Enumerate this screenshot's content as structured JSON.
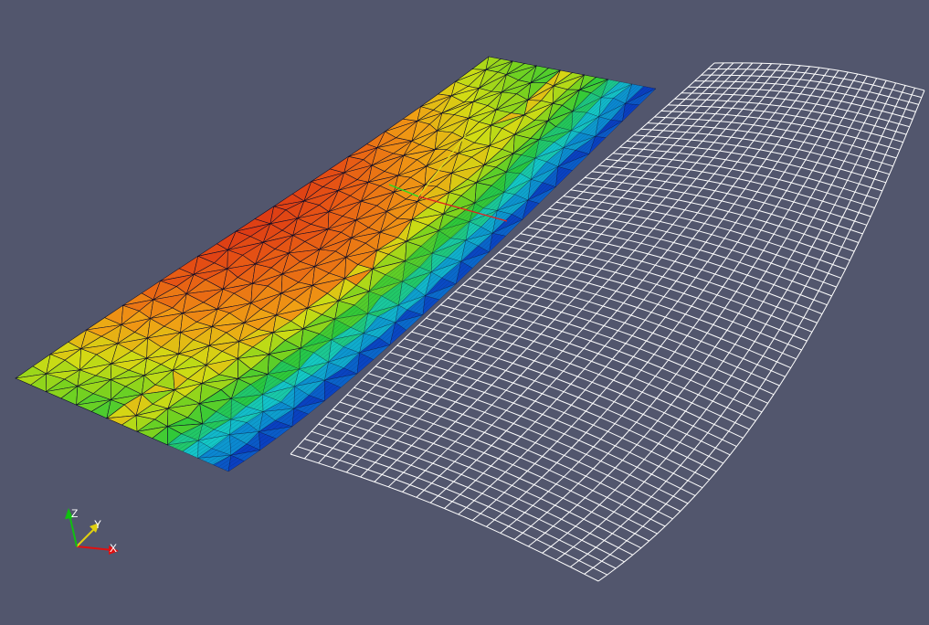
{
  "viewport": {
    "background_color": "#52566d"
  },
  "left_mesh": {
    "representation": "surface-with-edges",
    "edge_color": "#0a0a28",
    "colormap": [
      "#0a14b4",
      "#0a82d2",
      "#14c8c8",
      "#28c83c",
      "#7ad21e",
      "#d2dc14",
      "#f0a014",
      "#e65514",
      "#d21e14"
    ]
  },
  "right_mesh": {
    "representation": "wireframe",
    "line_color": "#ffffff"
  },
  "center_axes": {
    "x_color": "#dd2222",
    "y_color": "#dddd22",
    "z_color": "#22dd22"
  },
  "orientation_axes": {
    "x_label": "X",
    "y_label": "Y",
    "z_label": "Z",
    "x_color": "#e01010",
    "y_color": "#e0d010",
    "z_color": "#10c010"
  }
}
